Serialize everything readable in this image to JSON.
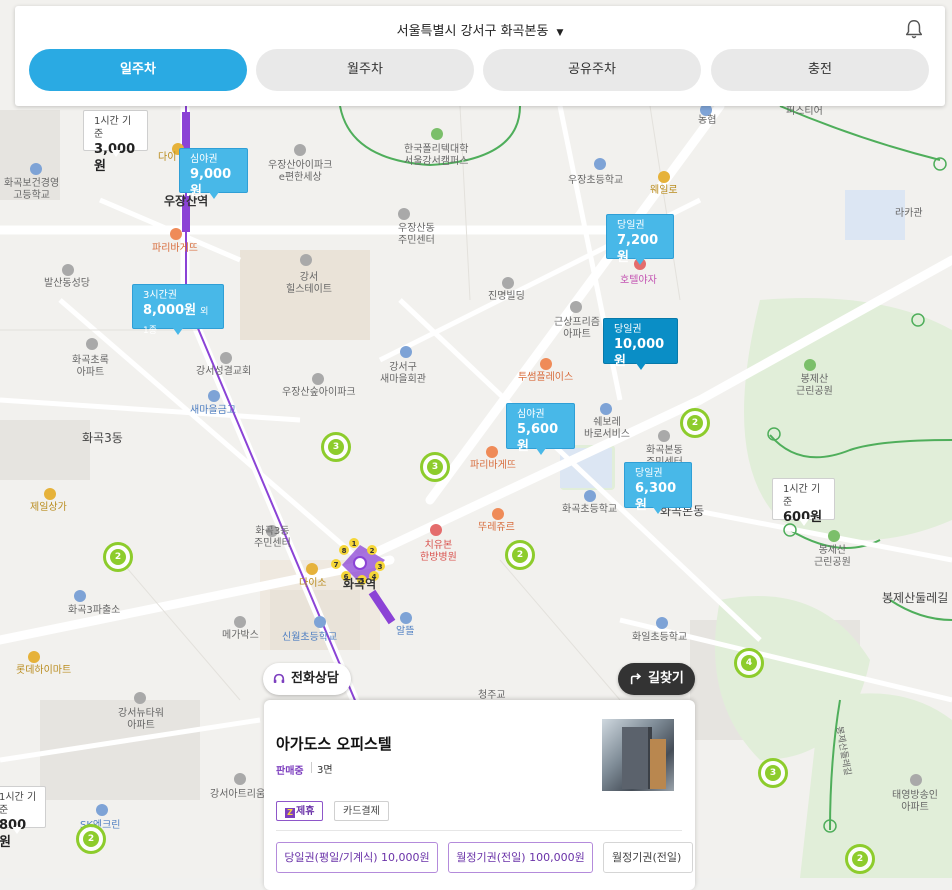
{
  "header": {
    "location": "서울특별시 강서구 화곡본동",
    "caret": "▼",
    "tabs": [
      {
        "label": "일주차",
        "active": true
      },
      {
        "label": "월주차",
        "active": false
      },
      {
        "label": "공유주차",
        "active": false
      },
      {
        "label": "충전",
        "active": false
      }
    ]
  },
  "price_markers": [
    {
      "label": "1시간 기준",
      "price": "3,000원",
      "style": "white"
    },
    {
      "label": "심야권",
      "price": "9,000원",
      "style": "blue"
    },
    {
      "label": "당일권",
      "price": "7,200원",
      "style": "blue"
    },
    {
      "label": "3시간권",
      "price": "8,000원",
      "extra": "외 1종",
      "style": "blue"
    },
    {
      "label": "당일권",
      "price": "10,000원",
      "style": "dark"
    },
    {
      "label": "심야권",
      "price": "5,600원",
      "style": "blue"
    },
    {
      "label": "당일권",
      "price": "6,300원",
      "style": "blue"
    },
    {
      "label": "1시간 기준",
      "price": "600원",
      "style": "white"
    },
    {
      "label": "1시간 기준",
      "price": "800원",
      "style": "white"
    }
  ],
  "clusters": [
    "3",
    "3",
    "2",
    "2",
    "2",
    "4",
    "3",
    "2",
    "2"
  ],
  "map_labels": {
    "l1": "한국폴리텍대학\n서울강서캠퍼스",
    "l2": "우장산아이파크\ne편한세상",
    "l3": "우장산역",
    "l4": "파리바게뜨",
    "l5": "다이",
    "l6": "화곡보건경영\n고등학교",
    "l7": "우장초등학교",
    "l8": "웨일로",
    "l9": "농협",
    "l10": "퍼스티어",
    "l11": "라카관",
    "l12": "우장산동\n주민센터",
    "l13": "강서\n힐스테이트",
    "l14": "발산동성당",
    "l15": "진명빌딩",
    "l16": "호텔야자",
    "l17": "근상프리즘\n아파트",
    "l18": "화곡초록\n아파트",
    "l19": "강서성결교회",
    "l20": "강서구\n새마을회관",
    "l21": "우장산숲아이파크",
    "l22": "투썸플레이스",
    "l23": "새마을금고",
    "l24": "쉐보레\n바로서비스",
    "l25": "화곡본동\n주민센터",
    "l26": "봉제산\n근린공원",
    "l27": "화곡3동",
    "l28": "파리바게뜨",
    "l29": "제일상가",
    "l30": "화곡초등학교",
    "l31": "화곡본동",
    "l32": "뚜레쥬르",
    "l33": "치유본\n한방병원",
    "l34": "화곡3동\n주민센터",
    "l35": "화곡역",
    "l36": "다이소",
    "l37": "봉제산\n근린공원",
    "l38": "봉제산둘레길",
    "l39": "화곡3파출소",
    "l40": "메가박스",
    "l41": "신월초등학교",
    "l42": "알뜰",
    "l43": "화일초등학교",
    "l44": "롯데하이마트",
    "l45": "강서뉴타워\n아파트",
    "l46": "강서아트리움",
    "l47": "태영방송인\n아파트",
    "l48": "봉제산둘레길",
    "l49": "SK엔크린",
    "l50": "청주교"
  },
  "buttons": {
    "call": "전화상담",
    "route": "길찾기"
  },
  "card": {
    "name": "아가도스 오피스텔",
    "status": "판매중",
    "spaces": "3면",
    "tags": [
      "제휴",
      "카드결제"
    ],
    "tickets": [
      "당일권(평일/기계식) 10,000원",
      "월정기권(전일) 100,000원",
      "월정기권(전일)"
    ]
  },
  "colors": {
    "accent": "#2aaae3",
    "marker_blue": "#48b8e8",
    "marker_dark": "#0a8ec6",
    "cluster_green": "#8dcc2c",
    "subway_purple": "#8b43d6",
    "partner_purple": "#6a32a8"
  }
}
